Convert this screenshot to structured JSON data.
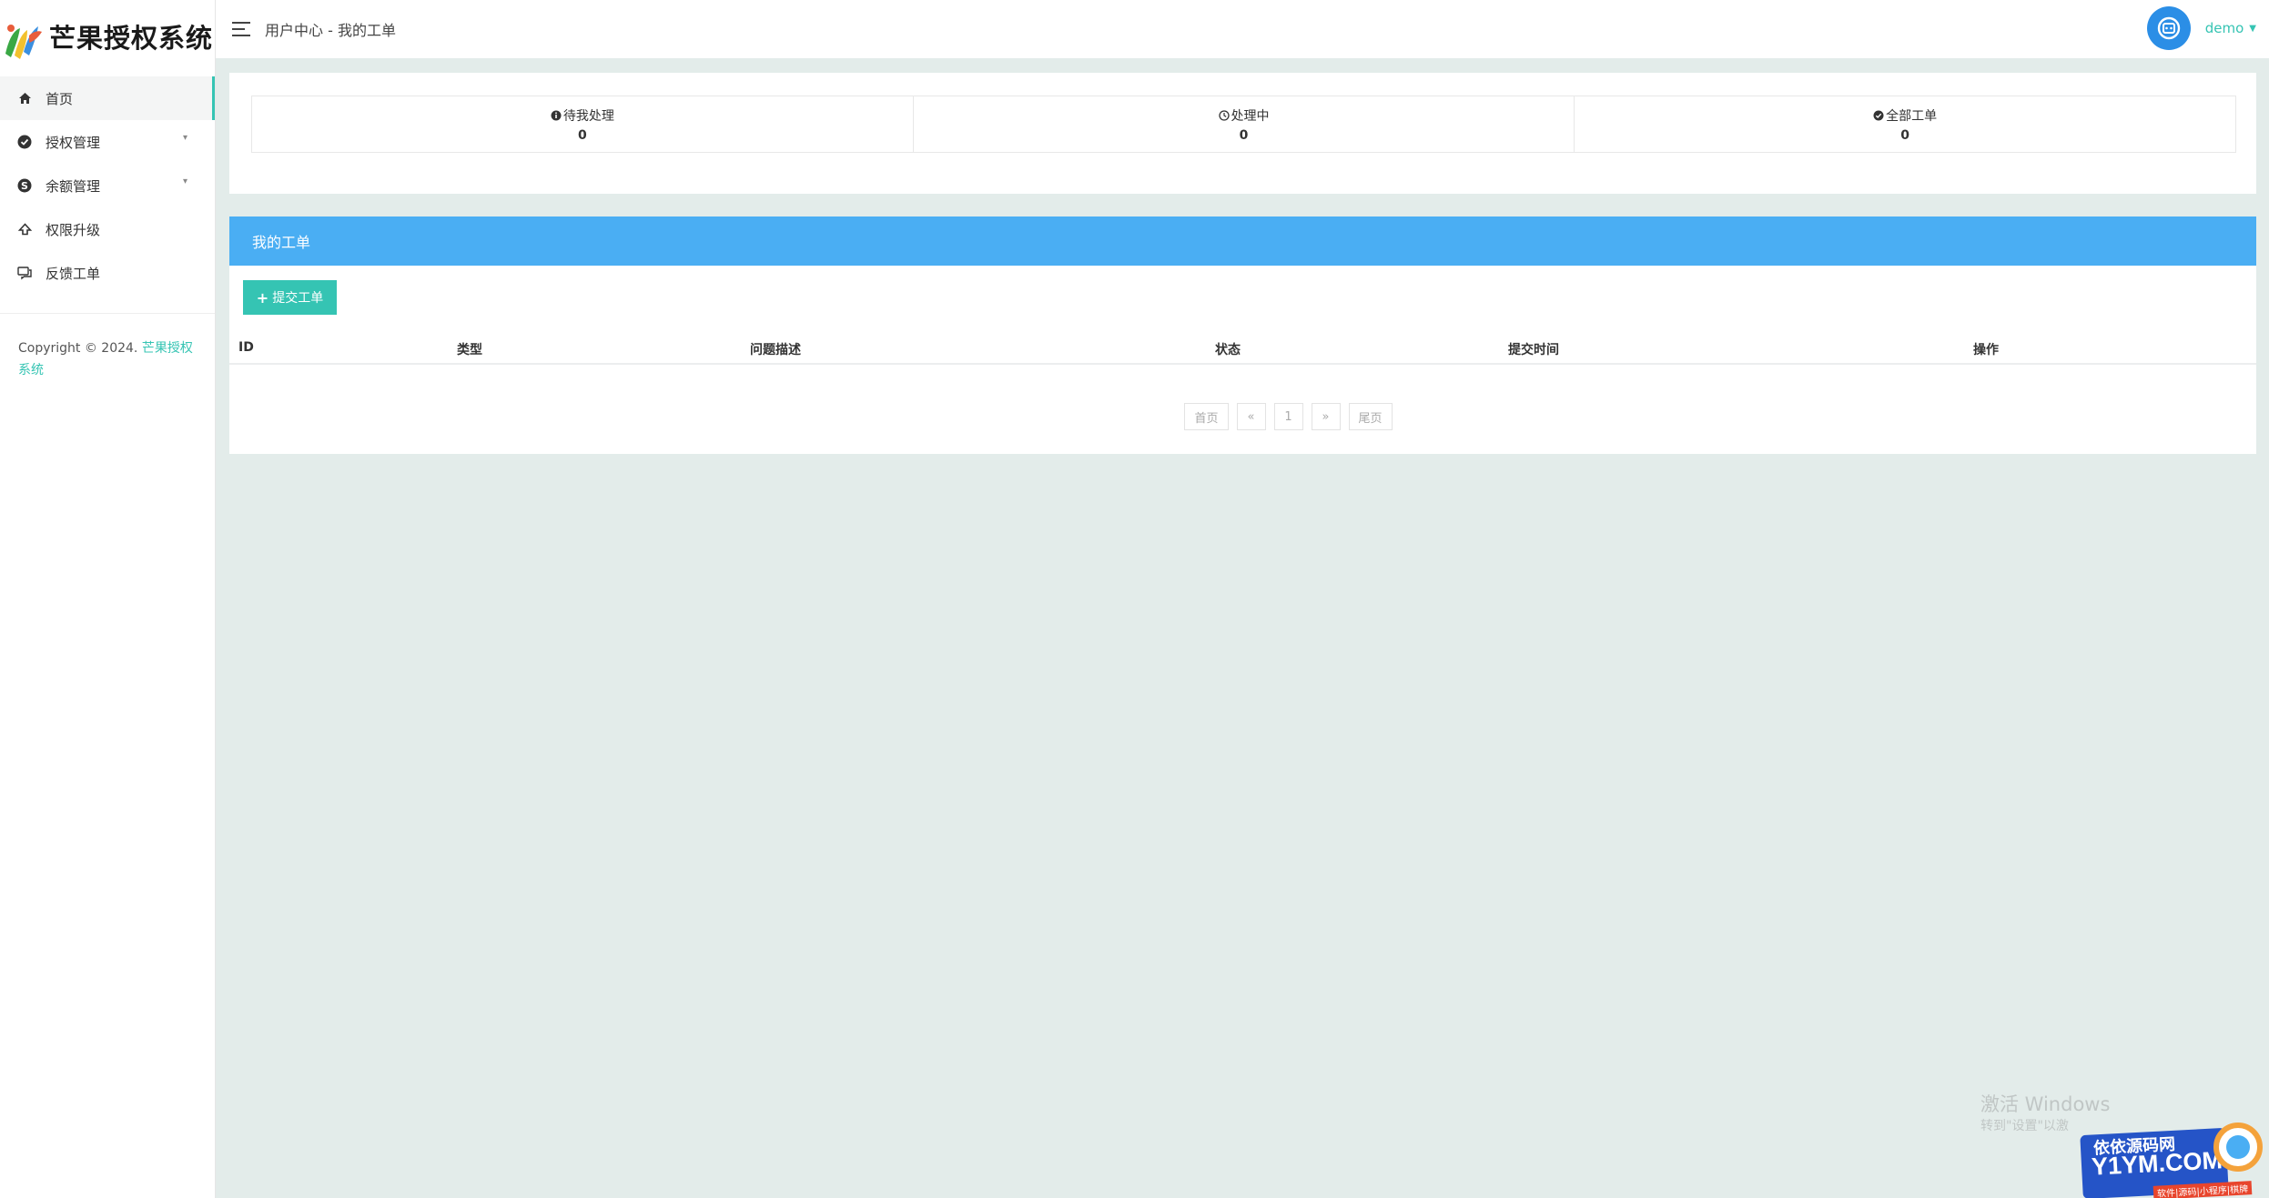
{
  "app": {
    "logo_text": "芒果授权系统"
  },
  "sidebar": {
    "items": [
      {
        "label": "首页",
        "icon": "home-icon"
      },
      {
        "label": "授权管理",
        "icon": "check-circle-icon"
      },
      {
        "label": "余额管理",
        "icon": "skype-icon"
      },
      {
        "label": "权限升级",
        "icon": "upgrade-icon"
      },
      {
        "label": "反馈工单",
        "icon": "comments-icon"
      }
    ],
    "copyright_prefix": "Copyright © 2024.",
    "copyright_link": "芒果授权系统"
  },
  "header": {
    "breadcrumb": "用户中心 - 我的工单",
    "username": "demo"
  },
  "stats": [
    {
      "label": "待我处理",
      "value": "0",
      "icon": "info-circle-icon"
    },
    {
      "label": "处理中",
      "value": "0",
      "icon": "clock-icon"
    },
    {
      "label": "全部工单",
      "value": "0",
      "icon": "check-circle-icon"
    }
  ],
  "tickets": {
    "panel_title": "我的工单",
    "submit_label": "提交工单",
    "columns": [
      "ID",
      "类型",
      "问题描述",
      "状态",
      "提交时间",
      "操作"
    ],
    "pagination": [
      "首页",
      "«",
      "1",
      "»",
      "尾页"
    ]
  },
  "watermark": {
    "line1": "激活 Windows",
    "line2": "转到\"设置\"以激",
    "badge_top": "依依源码网",
    "badge_main": "Y1YM.COM",
    "badge_sub": "软件|源码|小程序|棋牌"
  },
  "colors": {
    "accent": "#35c4b3",
    "panel_header": "#4aaef3",
    "background": "#e3ecea",
    "avatar": "#2b8ee6"
  }
}
